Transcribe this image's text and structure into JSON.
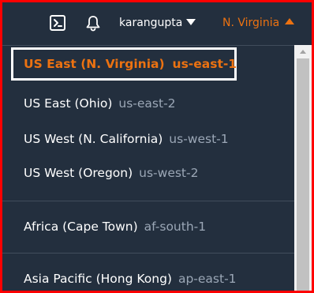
{
  "topbar": {
    "cloudshell_icon": "terminal-icon",
    "bell_icon": "bell-icon",
    "username": "karangupta",
    "region_label": "N. Virginia"
  },
  "colors": {
    "background": "#232f3e",
    "accent": "#ec7211",
    "secondary_text": "#9ba7b6",
    "highlight_border": "#ffffff",
    "frame_border": "#ff0000"
  },
  "regions": [
    {
      "name": "US East (N. Virginia)",
      "code": "us-east-1",
      "selected": true
    },
    {
      "name": "US East (Ohio)",
      "code": "us-east-2"
    },
    {
      "name": "US West (N. California)",
      "code": "us-west-1"
    },
    {
      "name": "US West (Oregon)",
      "code": "us-west-2"
    },
    {
      "name": "Africa (Cape Town)",
      "code": "af-south-1"
    },
    {
      "name": "Asia Pacific (Hong Kong)",
      "code": "ap-east-1"
    }
  ]
}
